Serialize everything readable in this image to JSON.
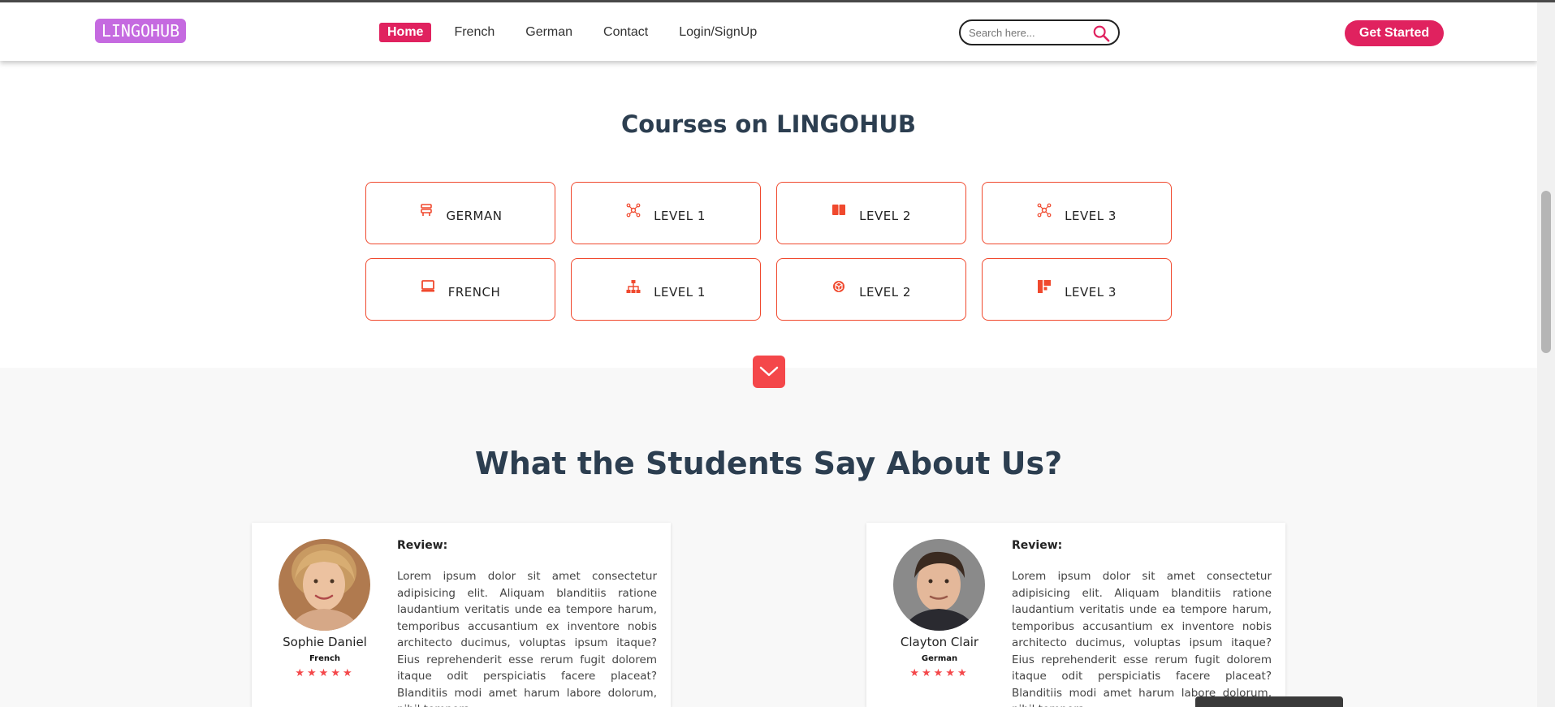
{
  "brand": {
    "logo_text": "LINGOHUB",
    "accent": "#e0225f",
    "logo_color": "#c56ae0",
    "card_border": "#f0492e"
  },
  "nav": {
    "links": [
      {
        "label": "Home",
        "active": true
      },
      {
        "label": "French"
      },
      {
        "label": "German"
      },
      {
        "label": "Contact"
      },
      {
        "label": "Login/SignUp"
      }
    ],
    "search_placeholder": "Search here...",
    "cta_label": "Get Started"
  },
  "courses": {
    "title": "Courses on LINGOHUB",
    "cards": [
      {
        "label": "GERMAN",
        "icon": "window-icon"
      },
      {
        "label": "LEVEL 1",
        "icon": "network-icon"
      },
      {
        "label": "LEVEL 2",
        "icon": "book-icon"
      },
      {
        "label": "LEVEL 3",
        "icon": "network-icon"
      },
      {
        "label": "FRENCH",
        "icon": "laptop-icon"
      },
      {
        "label": "LEVEL 1",
        "icon": "sitemap-icon"
      },
      {
        "label": "LEVEL 2",
        "icon": "cubes-icon"
      },
      {
        "label": "LEVEL 3",
        "icon": "layout-icon"
      }
    ]
  },
  "reviews": {
    "title": "What the Students Say About Us?",
    "items": [
      {
        "name": "Sophie Daniel",
        "language": "French",
        "stars": "★★★★★",
        "heading": "Review:",
        "text": "Lorem ipsum dolor sit amet consectetur adipisicing elit. Aliquam blanditiis ratione laudantium veritatis unde ea tempore harum, temporibus accusantium ex inventore nobis architecto ducimus, voluptas ipsum itaque? Eius reprehenderit esse rerum fugit dolorem itaque odit perspiciatis facere placeat? Blanditiis modi amet harum labore dolorum, nihil tempora"
      },
      {
        "name": "Clayton Clair",
        "language": "German",
        "stars": "★★★★★",
        "heading": "Review:",
        "text": "Lorem ipsum dolor sit amet consectetur adipisicing elit. Aliquam blanditiis ratione laudantium veritatis unde ea tempore harum, temporibus accusantium ex inventore nobis architecto ducimus, voluptas ipsum itaque? Eius reprehenderit esse rerum fugit dolorem itaque odit perspiciatis facere placeat? Blanditiis modi amet harum labore dolorum, nihil tempora"
      }
    ]
  }
}
